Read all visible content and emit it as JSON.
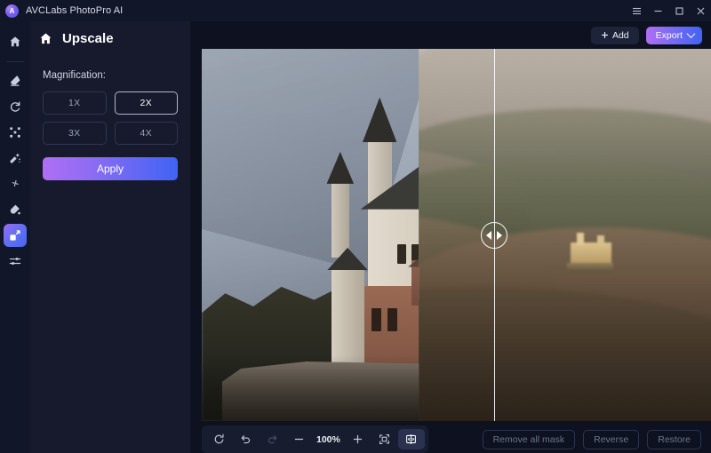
{
  "titlebar": {
    "app_name": "AVCLabs PhotoPro AI",
    "logo_icon": "avclabs-logo-icon",
    "menu_icon": "hamburger-menu-icon",
    "minimize_icon": "minimize-icon",
    "maximize_icon": "maximize-icon",
    "close_icon": "close-icon"
  },
  "rail": {
    "items": [
      {
        "icon": "home-icon",
        "name": "home",
        "active": false
      },
      {
        "icon": "eraser-icon",
        "name": "object-remover",
        "active": false
      },
      {
        "icon": "refresh-icon",
        "name": "photo-restore",
        "active": false
      },
      {
        "icon": "expand-corners-icon",
        "name": "background-remover",
        "active": false
      },
      {
        "icon": "magic-wand-icon",
        "name": "retouch",
        "active": false
      },
      {
        "icon": "sparkle-icon",
        "name": "enhance",
        "active": false
      },
      {
        "icon": "color-drop-icon",
        "name": "colorize",
        "active": false
      },
      {
        "icon": "upscale-arrow-icon",
        "name": "upscale",
        "active": true
      },
      {
        "icon": "sliders-icon",
        "name": "adjust",
        "active": false
      }
    ]
  },
  "panel": {
    "home_icon": "home-icon",
    "title": "Upscale",
    "magnification_label": "Magnification:",
    "magnification_options": [
      {
        "label": "1X",
        "selected": false
      },
      {
        "label": "2X",
        "selected": true
      },
      {
        "label": "3X",
        "selected": false
      },
      {
        "label": "4X",
        "selected": false
      }
    ],
    "apply_label": "Apply"
  },
  "stage_top": {
    "add_label": "Add",
    "add_icon": "plus-icon",
    "export_label": "Export",
    "export_chevron_icon": "chevron-down-icon"
  },
  "viewer": {
    "image_subject": "Neuschwanstein Castle",
    "compare_split_position_percent": 57,
    "handle_icon": "compare-drag-handle-icon",
    "left_arrow_icon": "triangle-left-icon",
    "right_arrow_icon": "triangle-right-icon"
  },
  "toolbar": {
    "rotate_icon": "rotate-icon",
    "undo_icon": "undo-icon",
    "redo_icon": "redo-icon",
    "zoom_out_icon": "minus-icon",
    "zoom_value": "100%",
    "zoom_in_icon": "plus-icon",
    "fit_screen_icon": "fit-to-screen-icon",
    "compare_icon": "split-compare-icon",
    "remove_all_mask_label": "Remove all mask",
    "reverse_label": "Reverse",
    "restore_label": "Restore"
  },
  "colors": {
    "accent_purple": "#b06ef5",
    "accent_blue": "#3f63f4",
    "panel_bg": "#161a2c",
    "rail_bg": "#121629",
    "stage_bg": "#0e1220"
  }
}
